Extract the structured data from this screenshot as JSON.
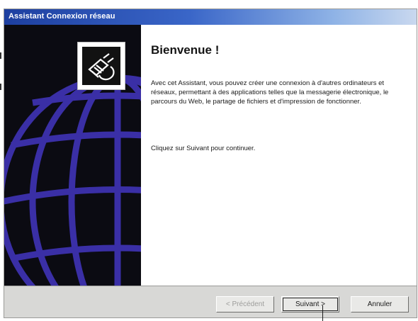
{
  "window": {
    "title": "Assistant Connexion réseau"
  },
  "welcome": {
    "heading": "Bienvenue !",
    "paragraph": "Avec cet Assistant, vous pouvez créer une connexion à d'autres ordinateurs et réseaux, permettant à des applications telles que la messagerie électronique, le parcours du Web, le partage de fichiers et d'impression de fonctionner.",
    "instruction": "Cliquez sur Suivant pour continuer."
  },
  "buttons": {
    "previous": "< Précédent",
    "next": "Suivant >",
    "cancel": "Annuler"
  },
  "icons": {
    "wizard": "network-connection-plug-icon",
    "globe": "globe-graphic"
  },
  "colors": {
    "titlebar_start": "#1d3fa0",
    "titlebar_end": "#c9d8ef",
    "side_panel": "#0b0b12",
    "globe": "#3a2fa6"
  }
}
